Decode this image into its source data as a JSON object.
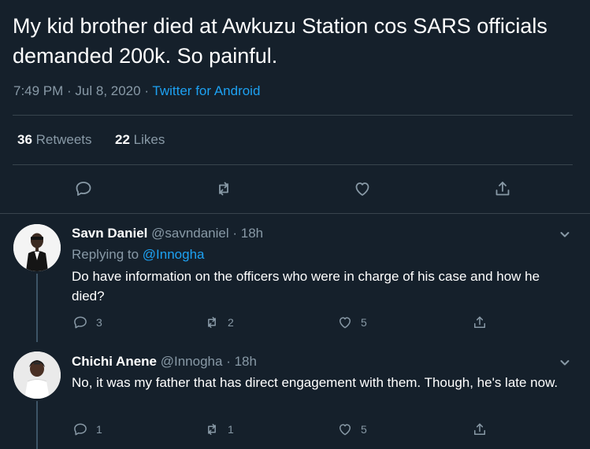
{
  "tweet": {
    "text": "My kid brother died at Awkuzu Station cos SARS officials demanded 200k. So painful.",
    "time": "7:49 PM · Jul 8, 2020 · ",
    "source": "Twitter for Android",
    "retweets_count": "36",
    "retweets_label": "Retweets",
    "likes_count": "22",
    "likes_label": "Likes"
  },
  "replies": [
    {
      "name": "Savn Daniel",
      "handle": "@savndaniel",
      "time": "· 18h",
      "replying_label": "Replying to ",
      "replying_handle": "@Innogha",
      "text": "Do have information on the officers who were in charge of his case and how he died?",
      "reply_count": "3",
      "retweet_count": "2",
      "like_count": "5"
    },
    {
      "name": "Chichi Anene",
      "handle": "@Innogha",
      "time": "· 18h",
      "text": "No, it was my father that has direct engagement with them. Though, he's late now.",
      "reply_count": "1",
      "retweet_count": "1",
      "like_count": "5"
    }
  ],
  "colors": {
    "background": "#15202b",
    "accent": "#1da1f2",
    "muted": "#8899a6",
    "divider": "#38444d"
  },
  "icons": {
    "reply": "reply-icon",
    "retweet": "retweet-icon",
    "like": "heart-icon",
    "share": "share-icon",
    "more": "chevron-down-icon"
  }
}
